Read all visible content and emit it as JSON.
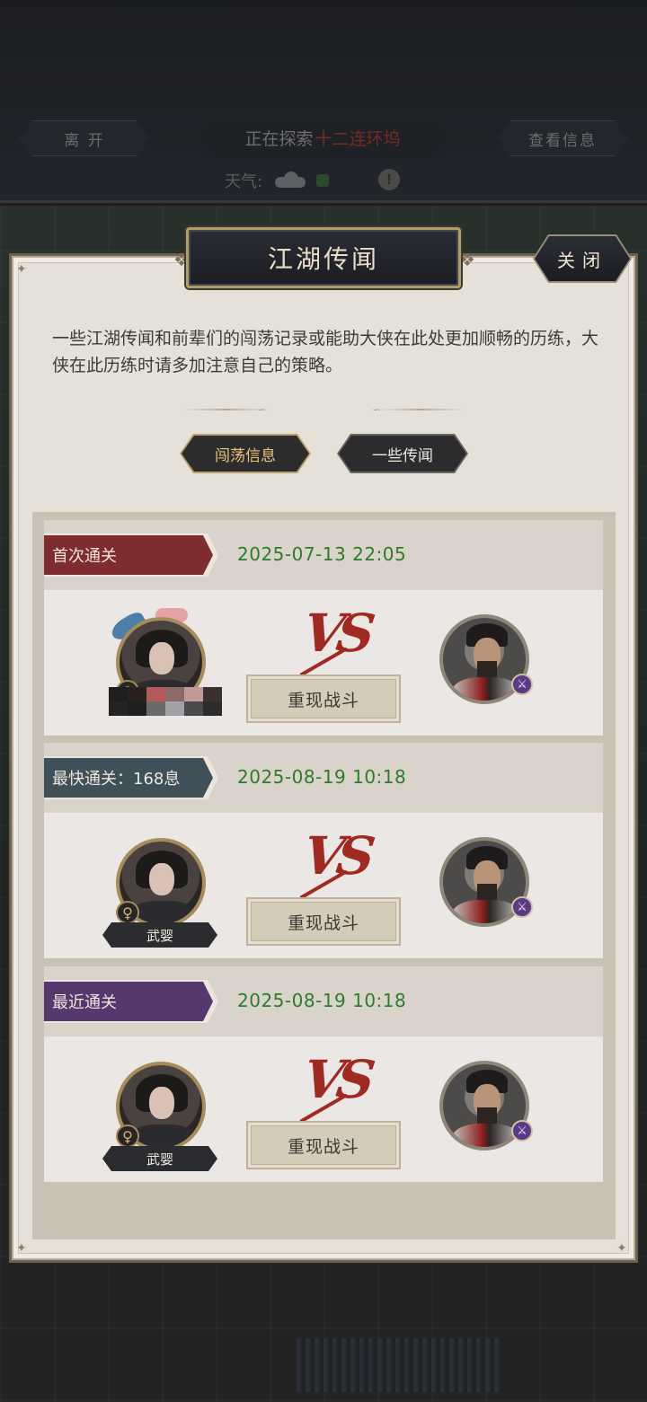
{
  "topbar": {
    "leave_label": "离 开",
    "exploring_prefix": "正在探索",
    "exploring_place": "十二连环坞",
    "view_info_label": "查看信息",
    "weather_label": "天气:",
    "warning_glyph": "!"
  },
  "panel": {
    "title": "江湖传闻",
    "close_label": "关闭",
    "intro": "一些江湖传闻和前辈们的闯荡记录或能助大侠在此处更加顺畅的历练，大侠在此历练时请多加注意自己的策略。",
    "tabs": [
      {
        "label": "闯荡信息",
        "active": true
      },
      {
        "label": "一些传闻",
        "active": false
      }
    ]
  },
  "records": [
    {
      "tag": "首次通关",
      "tag_color": "#7e2c2f",
      "date": "2025-07-13 22:05",
      "player_name": "",
      "player_gender": "♀",
      "player_name_obscured": true,
      "replay_label": "重现战斗",
      "enemy_role_icon": "sword-icon"
    },
    {
      "tag": "最快通关：168息",
      "tag_color": "#3f5058",
      "date": "2025-08-19 10:18",
      "player_name": "武婴",
      "player_gender": "♀",
      "player_name_obscured": false,
      "replay_label": "重现战斗",
      "enemy_role_icon": "sword-icon"
    },
    {
      "tag": "最近通关",
      "tag_color": "#54386e",
      "date": "2025-08-19 10:18",
      "player_name": "武婴",
      "player_gender": "♀",
      "player_name_obscured": false,
      "replay_label": "重现战斗",
      "enemy_role_icon": "sword-icon"
    }
  ],
  "vs_text": "VS",
  "colors": {
    "date_green": "#2e7c2a",
    "panel_bg": "#e6e1d8",
    "vs_red": "#9e2a22"
  }
}
